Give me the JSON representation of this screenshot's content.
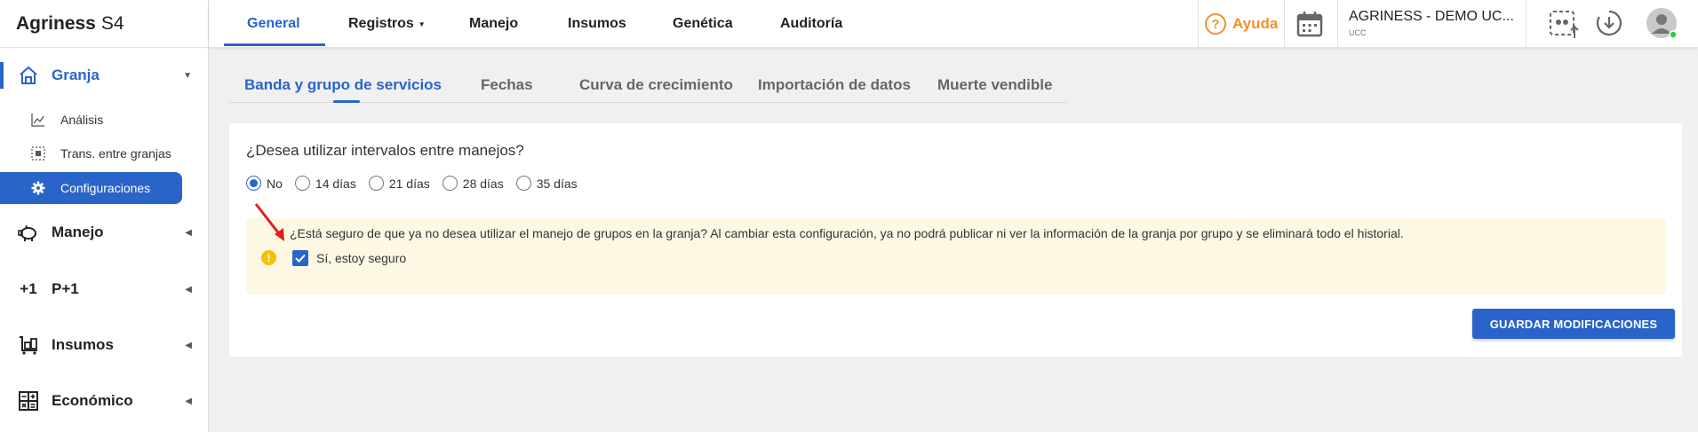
{
  "brand": {
    "name": "Agriness",
    "product": "S4"
  },
  "sidebar": {
    "granja": {
      "label": "Granja"
    },
    "sub_items": [
      {
        "label": "Análisis",
        "icon": "chart-line-icon"
      },
      {
        "label": "Trans. entre granjas",
        "icon": "transfer-icon"
      },
      {
        "label": "Configuraciones",
        "icon": "gear-icon"
      }
    ],
    "groups": [
      {
        "label": "Manejo",
        "icon": "pig-icon"
      },
      {
        "label": "P+1",
        "icon": "plus-one-icon"
      },
      {
        "label": "Insumos",
        "icon": "cart-icon"
      },
      {
        "label": "Económico",
        "icon": "calculator-icon"
      }
    ]
  },
  "topbar": {
    "menu": [
      "General",
      "Registros",
      "Manejo",
      "Insumos",
      "Genética",
      "Auditoría"
    ],
    "help_label": "Ayuda",
    "farm_name": "AGRINESS - DEMO UC...",
    "farm_sub": "UCC"
  },
  "tabs": [
    "Banda y grupo de servicios",
    "Fechas",
    "Curva de crecimiento",
    "Importación de datos",
    "Muerte vendible"
  ],
  "form": {
    "question": "¿Desea utilizar intervalos entre manejos?",
    "options": [
      "No",
      "14 días",
      "21 días",
      "28 días",
      "35 días"
    ],
    "selected": "No",
    "warning_text": "¿Está seguro de que ya no desea utilizar el manejo de grupos en la granja? Al cambiar esta configuración, ya no podrá publicar ni ver la información de la granja por grupo y se eliminará todo el historial.",
    "confirm_label": "Sí, estoy seguro",
    "confirm_checked": true,
    "save_label": "GUARDAR MODIFICACIONES"
  },
  "colors": {
    "primary": "#2a64c9",
    "help": "#f0912b",
    "warning_bg": "#fdf8e4",
    "warning_icon": "#f3c300",
    "annotation_arrow": "#e02020"
  }
}
